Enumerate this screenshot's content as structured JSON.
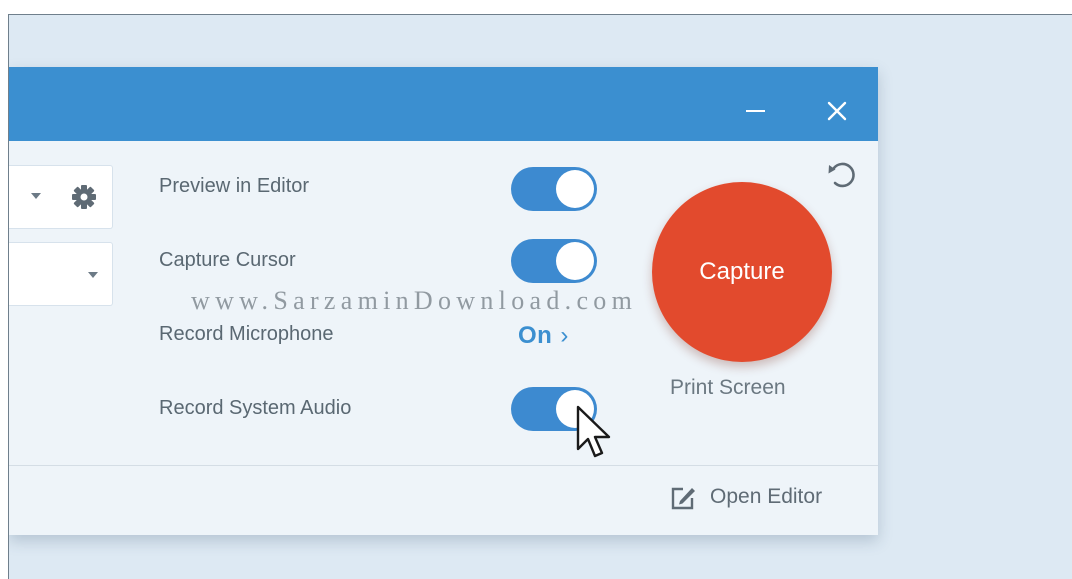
{
  "titlebar": {
    "minimize_icon": "minimize-icon",
    "close_icon": "close-icon",
    "color": "#3b8fd0"
  },
  "options": [
    {
      "label": "Preview in Editor",
      "control": "toggle",
      "state": "on"
    },
    {
      "label": "Capture Cursor",
      "control": "toggle",
      "state": "on"
    },
    {
      "label": "Record Microphone",
      "control": "link",
      "value": "On",
      "chevron": "›"
    },
    {
      "label": "Record System Audio",
      "control": "toggle",
      "state": "on"
    }
  ],
  "capture": {
    "label": "Capture",
    "hotkey": "Print Screen",
    "color": "#e24a2d"
  },
  "footer": {
    "open_editor_label": "Open Editor",
    "open_editor_icon": "edit-icon"
  },
  "watermark": "www.SarzaminDownload.com",
  "icons": {
    "settings": "gear-icon",
    "reset": "reset-icon",
    "dropdown": "chevron-down-icon",
    "pointer": "mouse-pointer-icon"
  },
  "accent_color": "#3d8ad0"
}
